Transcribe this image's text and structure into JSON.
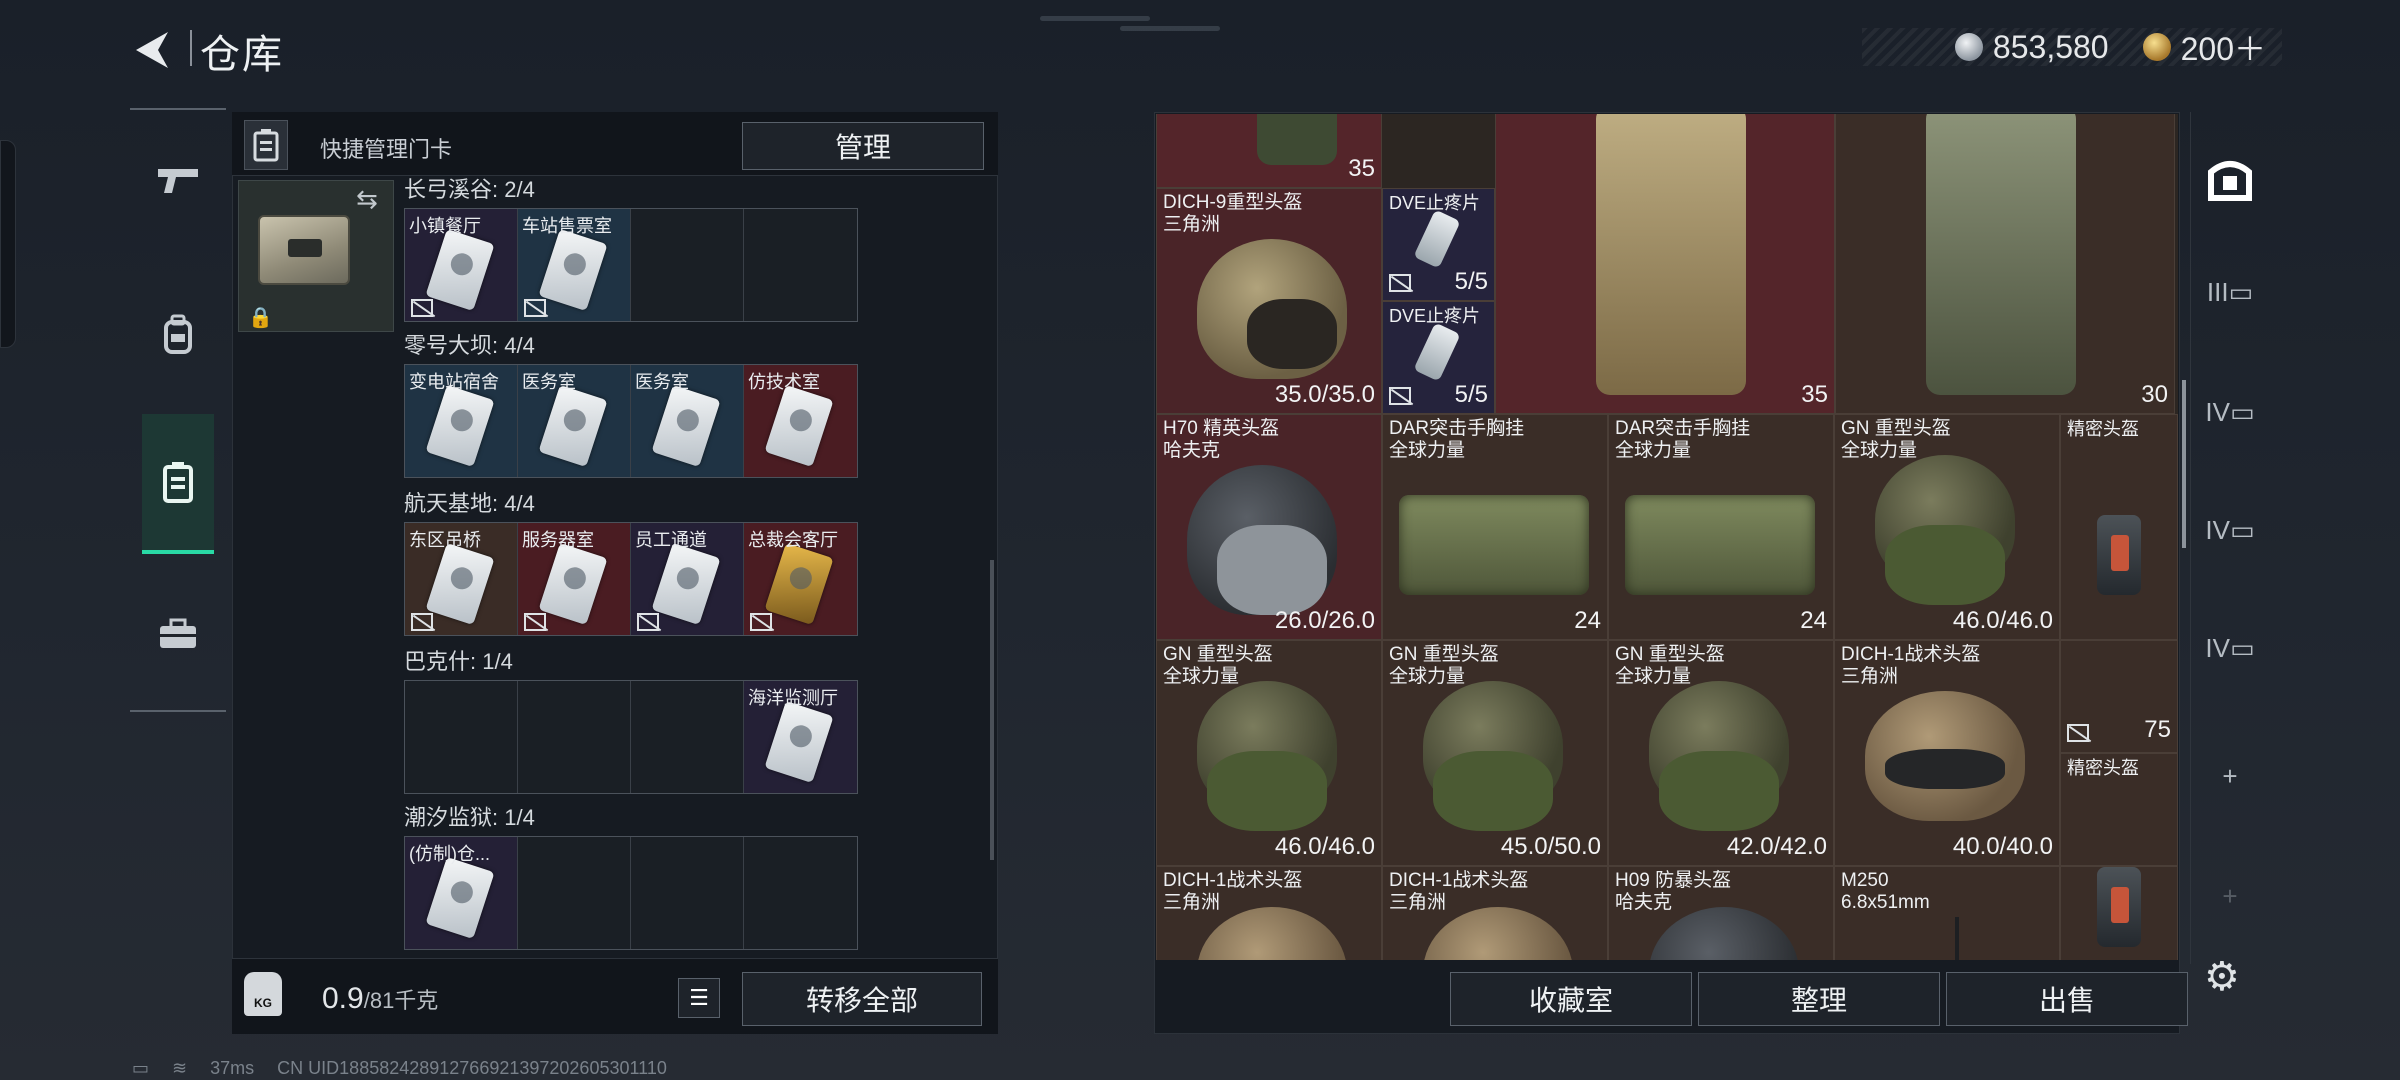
{
  "header": {
    "title": "仓库",
    "currency_silver": "853,580",
    "currency_gold": "200＋"
  },
  "left_panel": {
    "quick_manage_label": "快捷管理门卡",
    "manage_button": "管理",
    "groups": [
      {
        "label": "长弓溪谷: 2/4",
        "cells": [
          {
            "name": "小镇餐厅",
            "tint": "purple",
            "card": "white"
          },
          {
            "name": "车站售票室",
            "tint": "blue",
            "card": "white"
          },
          {
            "name": "",
            "tint": "",
            "card": ""
          },
          {
            "name": "",
            "tint": "",
            "card": ""
          }
        ]
      },
      {
        "label": "零号大坝: 4/4",
        "cells": [
          {
            "name": "变电站宿舍",
            "tint": "blue",
            "card": "white"
          },
          {
            "name": "医务室",
            "tint": "blue",
            "card": "white"
          },
          {
            "name": "医务室",
            "tint": "blue",
            "card": "white"
          },
          {
            "name": "仿技术室",
            "tint": "red",
            "card": "white"
          }
        ]
      },
      {
        "label": "航天基地: 4/4",
        "cells": [
          {
            "name": "东区吊桥",
            "tint": "brown",
            "card": "white"
          },
          {
            "name": "服务器室",
            "tint": "red",
            "card": "white"
          },
          {
            "name": "员工通道",
            "tint": "purple",
            "card": "white"
          },
          {
            "name": "总裁会客厅",
            "tint": "red",
            "card": "gold"
          }
        ]
      },
      {
        "label": "巴克什: 1/4",
        "cells": [
          {
            "name": "",
            "tint": "",
            "card": ""
          },
          {
            "name": "",
            "tint": "",
            "card": ""
          },
          {
            "name": "",
            "tint": "",
            "card": ""
          },
          {
            "name": "海洋监测厅",
            "tint": "purple",
            "card": "white"
          }
        ]
      },
      {
        "label": "潮汐监狱: 1/4",
        "cells": [
          {
            "name": "(仿制)仓...",
            "tint": "purple",
            "card": "white"
          },
          {
            "name": "",
            "tint": "",
            "card": ""
          },
          {
            "name": "",
            "tint": "",
            "card": ""
          },
          {
            "name": "",
            "tint": "",
            "card": ""
          }
        ]
      }
    ],
    "weight_value": "0.9",
    "weight_capacity": "/81千克",
    "transfer_all_button": "转移全部"
  },
  "stash": {
    "items": [
      {
        "name": "",
        "value": "35",
        "icon": "helmet-icon"
      },
      {
        "name": "DICH-9重型头盔\n三角洲",
        "value": "35.0/35.0"
      },
      {
        "name": "DVE止疼片",
        "value": "5/5"
      },
      {
        "name": "DVE止疼片",
        "value": "5/5"
      },
      {
        "name": "",
        "value": "35"
      },
      {
        "name": "",
        "value": "30"
      },
      {
        "name": "H70 精英头盔\n哈夫克",
        "value": "26.0/26.0"
      },
      {
        "name": "DAR突击手胸挂\n全球力量",
        "value": "24"
      },
      {
        "name": "DAR突击手胸挂\n全球力量",
        "value": "24"
      },
      {
        "name": "GN 重型头盔\n全球力量",
        "value": "46.0/46.0"
      },
      {
        "name": "精密头盔",
        "value": ""
      },
      {
        "name": "GN 重型头盔\n全球力量",
        "value": "46.0/46.0"
      },
      {
        "name": "GN 重型头盔\n全球力量",
        "value": "45.0/50.0"
      },
      {
        "name": "GN 重型头盔\n全球力量",
        "value": "42.0/42.0"
      },
      {
        "name": "DICH-1战术头盔\n三角洲",
        "value": "40.0/40.0"
      },
      {
        "name": "",
        "value": "75"
      },
      {
        "name": "精密头盔",
        "value": ""
      },
      {
        "name": "DICH-1战术头盔\n三角洲",
        "value": ""
      },
      {
        "name": "DICH-1战术头盔\n三角洲",
        "value": ""
      },
      {
        "name": "H09 防暴头盔\n哈夫克",
        "value": ""
      },
      {
        "name": "M250\n6.8x51mm",
        "value": ""
      }
    ]
  },
  "bottom_buttons": {
    "collection": "收藏室",
    "organize": "整理",
    "sell": "出售"
  },
  "status_bar": {
    "ping": "37ms",
    "uid": "CN UID18858242891276692139720260530​1110"
  },
  "colors": {
    "accent_green": "#29d9a5",
    "item_red": "#54252a",
    "item_purple": "#25233c"
  }
}
